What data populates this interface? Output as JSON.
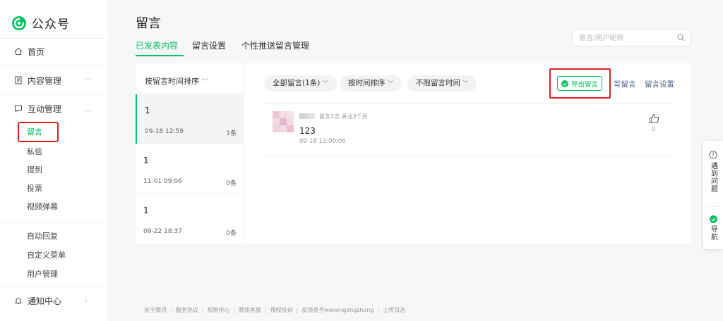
{
  "app": {
    "logo_text": "公众号"
  },
  "sidebar": {
    "home": "首页",
    "content": "内容管理",
    "interaction": "互动管理",
    "sub_items": [
      "留言",
      "私信",
      "提到",
      "投票",
      "视频弹幕"
    ],
    "tools": [
      "自动回复",
      "自定义菜单",
      "用户管理"
    ],
    "notice": "通知中心"
  },
  "header": {
    "title": "留言",
    "tabs": [
      "已发表内容",
      "留言设置",
      "个性推送留言管理"
    ],
    "search_placeholder": "留言/用户昵称"
  },
  "list": {
    "sort_label": "按留言时间排序",
    "items": [
      {
        "title": "1",
        "date": "09-18 12:59",
        "count": "1条"
      },
      {
        "title": "1",
        "date": "11-01 09:06",
        "count": "0条"
      },
      {
        "title": "1",
        "date": "09-22 18:37",
        "count": "0条"
      }
    ]
  },
  "toolbar": {
    "filter_all": "全部留言(1条)",
    "filter_sort": "按时间排序",
    "filter_time": "不限留言时间",
    "export": "导出留言",
    "write": "写留言",
    "settings": "留言设置"
  },
  "comment": {
    "meta": "留言1次 关注3个月",
    "text": "123",
    "time": "09-18 13:00:06",
    "likes": "0"
  },
  "footer": [
    "关于腾讯",
    "服务协议",
    "规则中心",
    "腾讯客服",
    "侵权投诉",
    "反馈查号weixingongzhong",
    "上传日志"
  ],
  "float": {
    "help": "遇到问题",
    "nav": "导航"
  },
  "colors": {
    "accent": "#07c160",
    "highlight": "#e02020",
    "link": "#4a5d8a"
  }
}
